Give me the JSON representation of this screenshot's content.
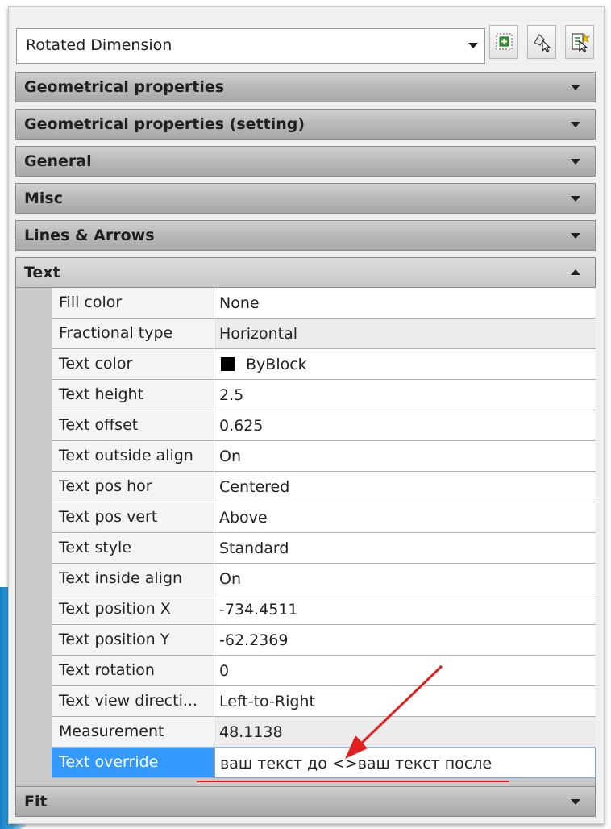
{
  "object_type_selector": {
    "value": "Rotated Dimension"
  },
  "toolbar": {
    "buttons": [
      {
        "icon": "toggle-pickadd-icon"
      },
      {
        "icon": "select-objects-icon"
      },
      {
        "icon": "quick-select-icon"
      }
    ]
  },
  "sections": {
    "geometrical": {
      "label": "Geometrical properties"
    },
    "geometrical_setting": {
      "label": "Geometrical properties (setting)"
    },
    "general": {
      "label": "General"
    },
    "misc": {
      "label": "Misc"
    },
    "lines_arrows": {
      "label": "Lines & Arrows"
    },
    "text": {
      "label": "Text"
    },
    "fit": {
      "label": "Fit"
    }
  },
  "text_properties": [
    {
      "name": "Fill color",
      "value": "None"
    },
    {
      "name": "Fractional type",
      "value": "Horizontal"
    },
    {
      "name": "Text color",
      "value": "ByBlock"
    },
    {
      "name": "Text height",
      "value": "2.5"
    },
    {
      "name": "Text offset",
      "value": "0.625"
    },
    {
      "name": "Text outside align",
      "value": "On"
    },
    {
      "name": "Text pos hor",
      "value": "Centered"
    },
    {
      "name": "Text pos vert",
      "value": "Above"
    },
    {
      "name": "Text style",
      "value": "Standard"
    },
    {
      "name": "Text inside align",
      "value": "On"
    },
    {
      "name": "Text position X",
      "value": "-734.4511"
    },
    {
      "name": "Text position Y",
      "value": "-62.2369"
    },
    {
      "name": "Text rotation",
      "value": "0"
    },
    {
      "name": "Text view directi...",
      "value": "Left-to-Right"
    },
    {
      "name": "Measurement",
      "value": "48.1138"
    },
    {
      "name": "Text override",
      "value": "ваш текст до <>ваш текст после"
    }
  ],
  "colors": {
    "selected_row": "#3399ff",
    "annotation_arrow": "#e02020",
    "text_color_swatch": "#000000"
  }
}
